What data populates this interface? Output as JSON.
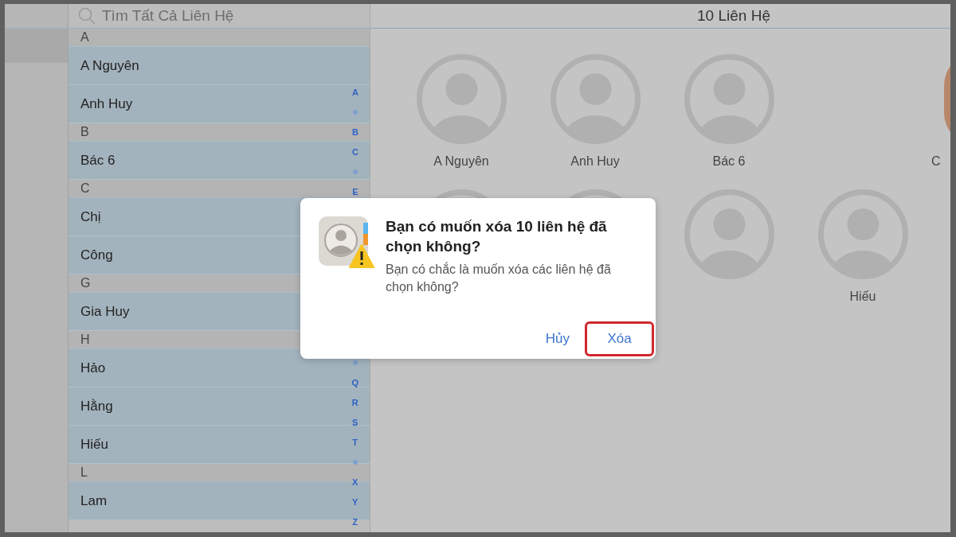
{
  "search": {
    "placeholder": "Tìm Tất Cả Liên Hệ"
  },
  "contact_list": [
    {
      "kind": "header",
      "label": "A"
    },
    {
      "kind": "contact",
      "name": "A Nguyên",
      "selected": true
    },
    {
      "kind": "contact",
      "name": "Anh Huy",
      "selected": true
    },
    {
      "kind": "header",
      "label": "B"
    },
    {
      "kind": "contact",
      "name": "Bác 6",
      "selected": true
    },
    {
      "kind": "header",
      "label": "C"
    },
    {
      "kind": "contact",
      "name": "Chị",
      "selected": true
    },
    {
      "kind": "contact",
      "name": "Công",
      "selected": true
    },
    {
      "kind": "header",
      "label": "G"
    },
    {
      "kind": "contact",
      "name": "Gia Huy",
      "selected": true
    },
    {
      "kind": "header",
      "label": "H"
    },
    {
      "kind": "contact",
      "name": "Hảo",
      "selected": true
    },
    {
      "kind": "contact",
      "name": "Hằng",
      "selected": true
    },
    {
      "kind": "contact",
      "name": "Hiếu",
      "selected": true
    },
    {
      "kind": "header",
      "label": "L"
    },
    {
      "kind": "contact",
      "name": "Lam",
      "selected": true
    }
  ],
  "index_top": [
    {
      "kind": "letter",
      "label": "A"
    },
    {
      "kind": "dot"
    },
    {
      "kind": "letter",
      "label": "B"
    },
    {
      "kind": "letter",
      "label": "C"
    },
    {
      "kind": "dot"
    },
    {
      "kind": "letter",
      "label": "E"
    }
  ],
  "index_bottom": [
    {
      "kind": "dot"
    },
    {
      "kind": "letter",
      "label": "Q"
    },
    {
      "kind": "letter",
      "label": "R"
    },
    {
      "kind": "letter",
      "label": "S"
    },
    {
      "kind": "letter",
      "label": "T"
    },
    {
      "kind": "dot"
    },
    {
      "kind": "letter",
      "label": "X"
    },
    {
      "kind": "letter",
      "label": "Y"
    },
    {
      "kind": "letter",
      "label": "Z"
    }
  ],
  "detail": {
    "title": "10 Liên Hệ",
    "cards": [
      {
        "kind": "placeholder",
        "name": "A Nguyên"
      },
      {
        "kind": "placeholder",
        "name": "Anh Huy"
      },
      {
        "kind": "placeholder",
        "name": "Bác 6"
      },
      {
        "kind": "empty"
      },
      {
        "kind": "photo",
        "name": "C"
      },
      {
        "kind": "placeholder"
      },
      {
        "kind": "placeholder"
      },
      {
        "kind": "placeholder"
      },
      {
        "kind": "placeholder",
        "name": "Hiếu"
      }
    ]
  },
  "dialog": {
    "title": "Bạn có muốn xóa 10 liên hệ đã chọn không?",
    "message": "Bạn có chắc là muốn xóa các liên hệ đã chọn không?",
    "buttons": [
      {
        "label": "Hủy",
        "highlighted": false
      },
      {
        "label": "Xóa",
        "highlighted": true
      }
    ]
  }
}
